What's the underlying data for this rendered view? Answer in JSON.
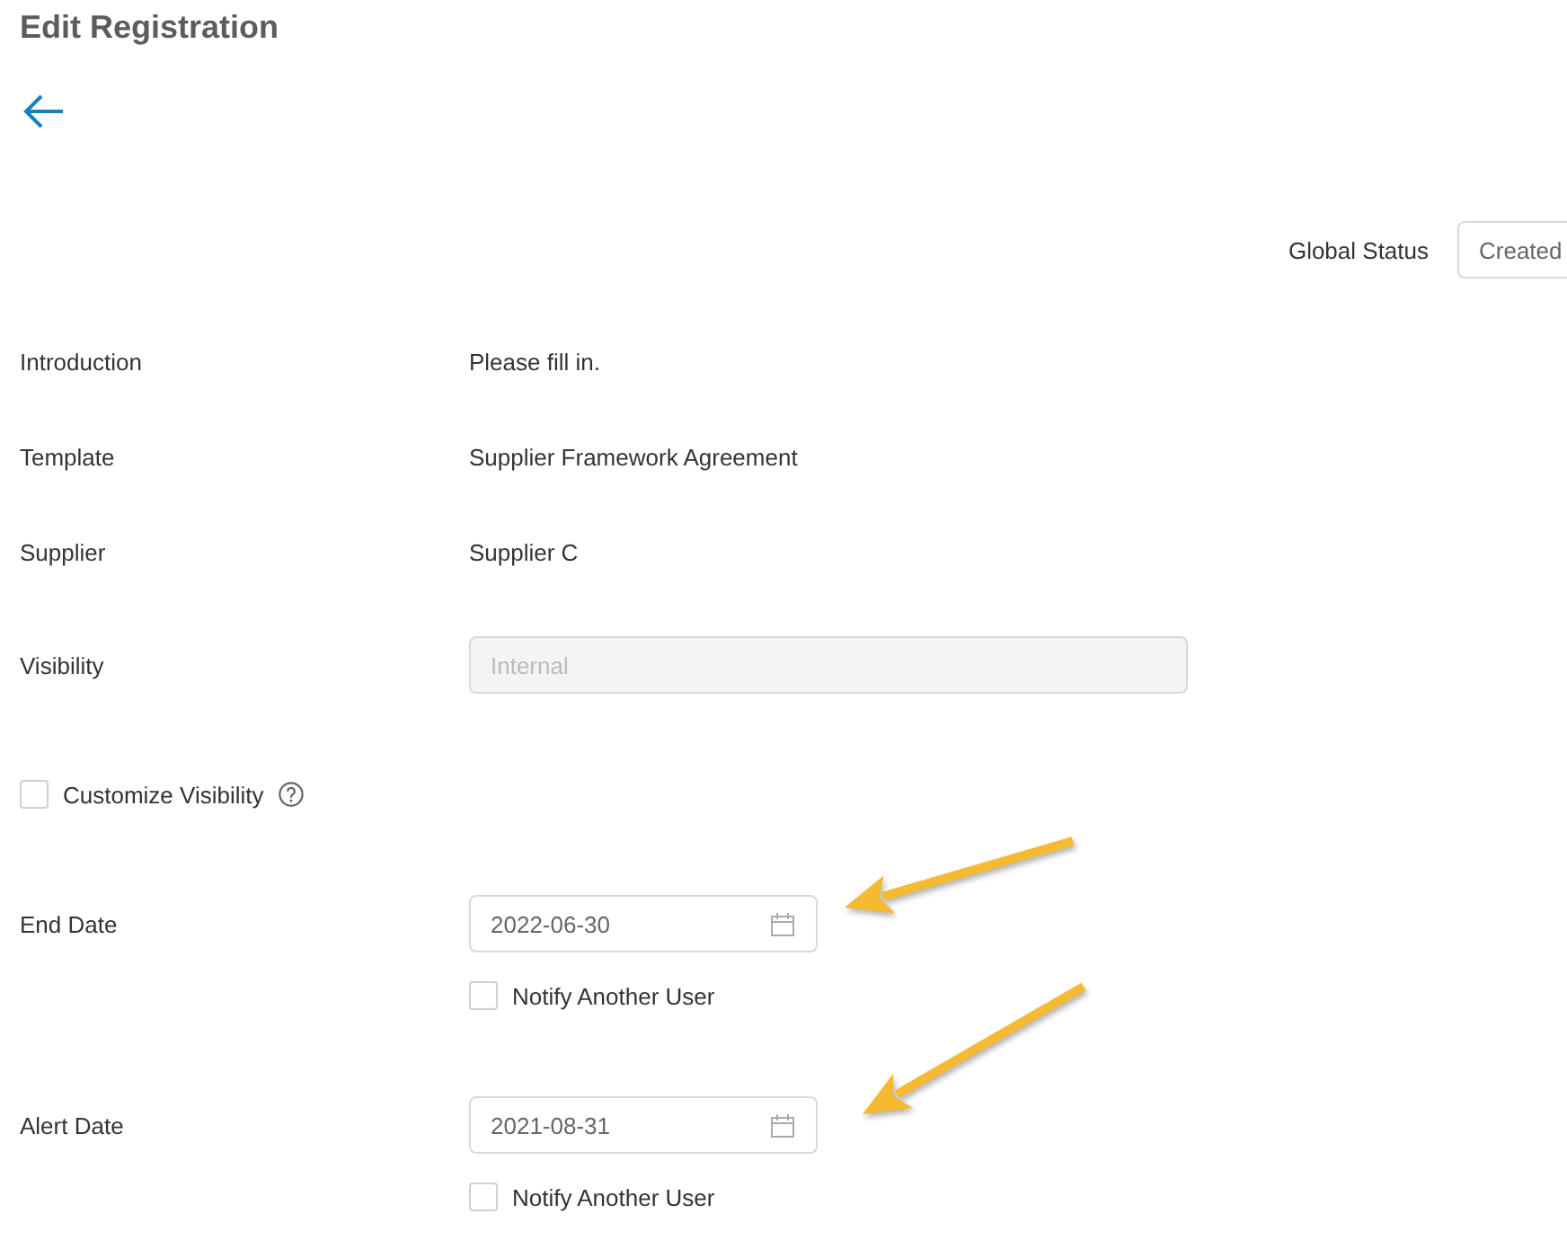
{
  "page": {
    "title": "Edit Registration"
  },
  "global_status": {
    "label": "Global Status",
    "value": "Created"
  },
  "fields": [
    {
      "kind": "text",
      "label": "Introduction",
      "value": "Please fill in."
    },
    {
      "kind": "text",
      "label": "Template",
      "value": "Supplier Framework Agreement"
    },
    {
      "kind": "text",
      "label": "Supplier",
      "value": "Supplier C"
    },
    {
      "kind": "input",
      "label": "Visibility",
      "value": "Internal",
      "disabled": true
    },
    {
      "kind": "checkbox",
      "label": "Customize Visibility",
      "checked": false
    },
    {
      "kind": "date",
      "label": "End Date",
      "value": "2022-06-30",
      "highlighted": true,
      "notify": {
        "label": "Notify Another User",
        "checked": false
      }
    },
    {
      "kind": "date",
      "label": "Alert Date",
      "value": "2021-08-31",
      "highlighted": true,
      "notify": {
        "label": "Notify Another User",
        "checked": false
      }
    }
  ]
}
